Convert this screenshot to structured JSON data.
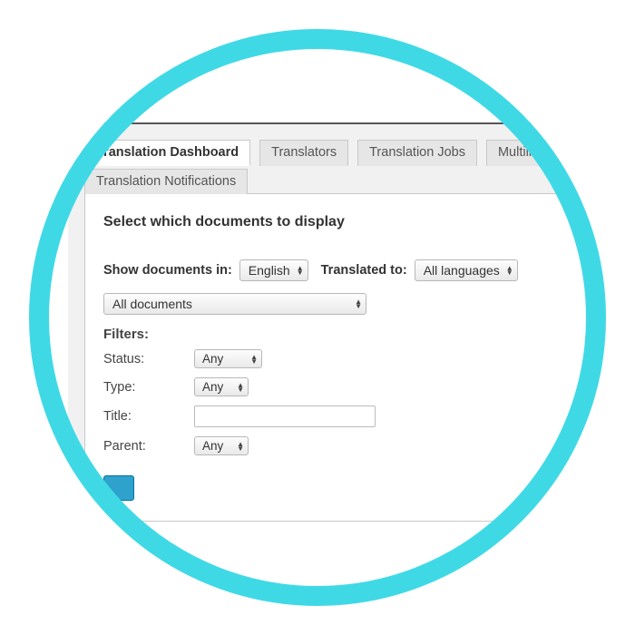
{
  "tabs": {
    "primary": [
      {
        "label": "Translation Dashboard",
        "active": true
      },
      {
        "label": "Translators"
      },
      {
        "label": "Translation Jobs"
      },
      {
        "label": "Multilingual"
      }
    ],
    "secondary": [
      {
        "label": "Translation Notifications"
      }
    ]
  },
  "panel": {
    "title": "Select which documents to display",
    "show_docs_label": "Show documents in:",
    "show_docs_value": "English",
    "translated_to_label": "Translated to:",
    "translated_to_value": "All languages",
    "scope_value": "All documents",
    "filters_label": "Filters:",
    "filters": {
      "status_label": "Status:",
      "status_value": "Any",
      "type_label": "Type:",
      "type_value": "Any",
      "title_label": "Title:",
      "title_value": "",
      "parent_label": "Parent:",
      "parent_value": "Any"
    }
  }
}
